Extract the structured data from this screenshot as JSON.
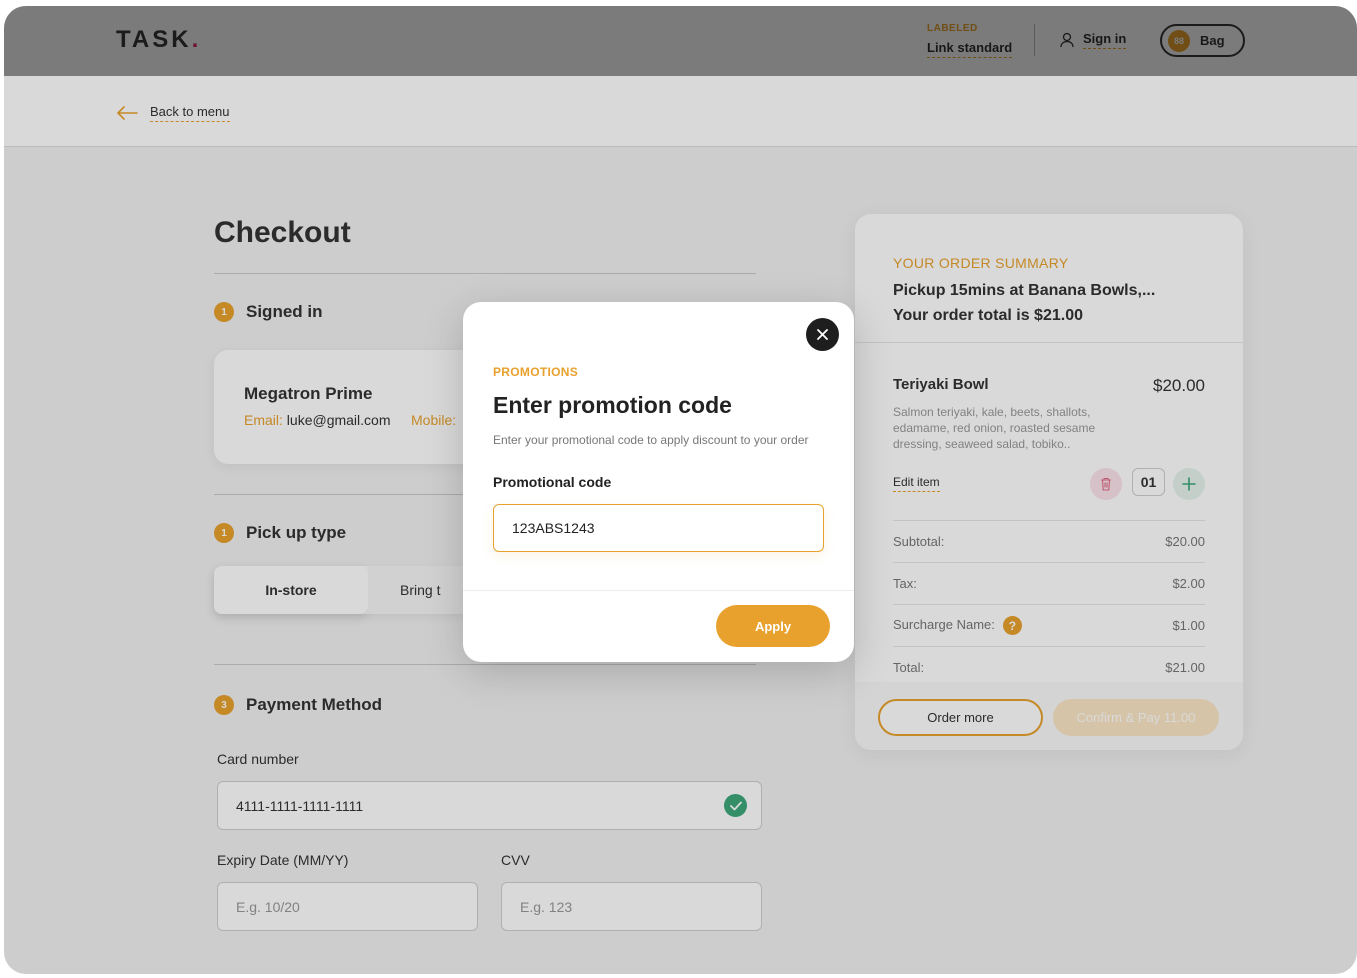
{
  "header": {
    "logo_text": "TASK",
    "logo_dot": ".",
    "labeled_kicker": "LABELED",
    "link_standard": "Link standard",
    "sign_in": "Sign in",
    "bag_count": "88",
    "bag_label": "Bag"
  },
  "nav": {
    "back_label": "Back to menu"
  },
  "checkout": {
    "title": "Checkout",
    "steps": [
      {
        "num": "1",
        "label": "Signed in"
      },
      {
        "num": "1",
        "label": "Pick up type"
      },
      {
        "num": "3",
        "label": "Payment Method"
      }
    ],
    "user": {
      "name": "Megatron Prime",
      "email_label": "Email:",
      "email_value": "luke@gmail.com",
      "mobile_label": "Mobile:"
    },
    "pickup": {
      "option_active": "In-store",
      "option_other": "Bring t"
    },
    "payment": {
      "card_label": "Card number",
      "card_value": "4111-1111-1111-1111",
      "expiry_label": "Expiry Date (MM/YY)",
      "expiry_placeholder": "E.g. 10/20",
      "cvv_label": "CVV",
      "cvv_placeholder": "E.g. 123"
    }
  },
  "summary": {
    "kicker": "YOUR ORDER SUMMARY",
    "line1": "Pickup 15mins at Banana Bowls,...",
    "line2": "Your order total is $21.00",
    "item": {
      "name": "Teriyaki Bowl",
      "price": "$20.00",
      "desc": "Salmon teriyaki, kale, beets, shallots, edamame, red onion, roasted sesame dressing, seaweed salad, tobiko..",
      "edit": "Edit item",
      "qty": "01"
    },
    "rows": [
      {
        "label": "Subtotal:",
        "value": "$20.00"
      },
      {
        "label": "Tax:",
        "value": "$2.00"
      },
      {
        "label": "Surcharge Name:",
        "value": "$1.00"
      },
      {
        "label": "Total:",
        "value": "$21.00"
      }
    ],
    "surcharge_help": "?",
    "order_more": "Order more",
    "confirm": "Confirm & Pay 11.00"
  },
  "modal": {
    "kicker": "PROMOTIONS",
    "title": "Enter promotion code",
    "desc": "Enter your promotional code to apply discount to your order",
    "label": "Promotional code",
    "input_value": "123ABS1243",
    "apply": "Apply"
  },
  "colors": {
    "accent": "#e8a12d",
    "logo_dot": "#e0306a",
    "success": "#3ea77b"
  }
}
